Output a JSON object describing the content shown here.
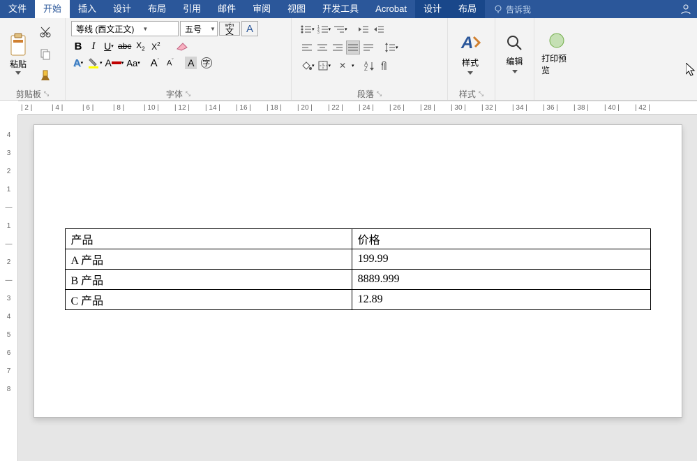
{
  "menu": {
    "file": "文件",
    "home": "开始",
    "insert": "插入",
    "design": "设计",
    "layout": "布局",
    "refs": "引用",
    "mail": "邮件",
    "review": "审阅",
    "view": "视图",
    "dev": "开发工具",
    "acrobat": "Acrobat",
    "design2": "设计",
    "layout2": "布局",
    "tell": "告诉我"
  },
  "ribbon": {
    "clipboard": {
      "paste": "粘贴",
      "group": "剪贴板"
    },
    "font": {
      "family": "等线 (西文正文)",
      "size": "五号",
      "wen": "wén",
      "wen2": "文",
      "group": "字体",
      "A": "A"
    },
    "paragraph": {
      "group": "段落"
    },
    "styles": {
      "label": "样式",
      "group": "样式"
    },
    "edit": {
      "label": "编辑"
    },
    "print": {
      "label": "打印预览"
    }
  },
  "ruler": {
    "h": [
      "2",
      "4",
      "6",
      "8",
      "10",
      "12",
      "14",
      "16",
      "18",
      "20",
      "22",
      "24",
      "26",
      "28",
      "30",
      "32",
      "34",
      "36",
      "38",
      "40",
      "42"
    ],
    "v": [
      "4",
      "3",
      "2",
      "1",
      "",
      "1",
      "",
      "2",
      "",
      "3",
      "4",
      "5",
      "6",
      "7",
      "8"
    ]
  },
  "table": {
    "headers": [
      "产品",
      "价格"
    ],
    "rows": [
      [
        "A 产品",
        "199.99"
      ],
      [
        "B 产品",
        "8889.999"
      ],
      [
        "C 产品",
        "12.89"
      ]
    ]
  }
}
